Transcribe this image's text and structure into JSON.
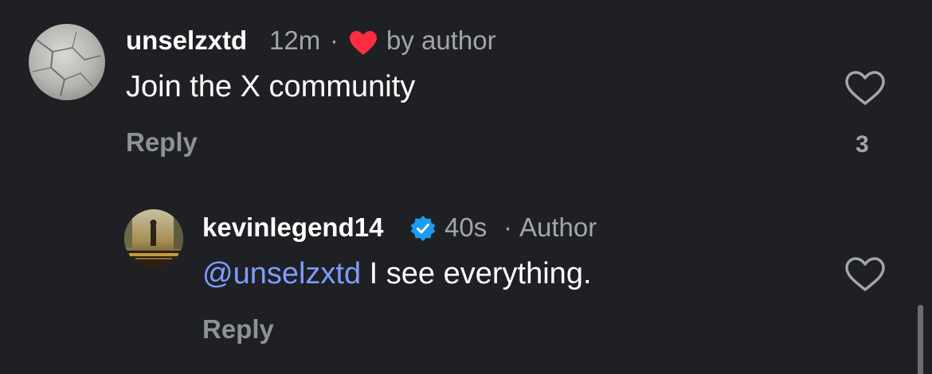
{
  "comments": [
    {
      "username": "unselzxtd",
      "time": "12m",
      "separator": "·",
      "liked_by_author_label": "by author",
      "text": "Join the X community",
      "reply_label": "Reply",
      "like_count": "3",
      "avatar_icon": "cracked-stone-avatar"
    },
    {
      "username": "kevinlegend14",
      "verified": true,
      "time": "40s",
      "separator": "·",
      "author_label": "Author",
      "mention": "@unselzxtd",
      "text": " I see everything.",
      "reply_label": "Reply",
      "avatar_icon": "movie-poster-avatar"
    }
  ],
  "colors": {
    "background": "#1f2024",
    "heart_red": "#ff2d3f",
    "mention_blue": "#7d9cff",
    "verified_blue": "#1d9bf0",
    "meta_gray": "#a3a5ad"
  }
}
